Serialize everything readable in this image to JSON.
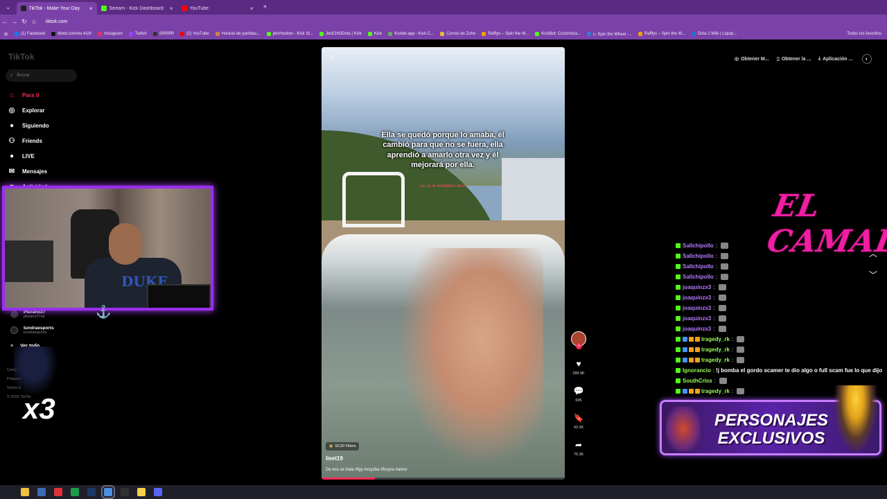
{
  "browser": {
    "tabs": [
      {
        "label": "TikTok - Make Your Day",
        "color": "#222222",
        "active": true
      },
      {
        "label": "Stream - Kick Dashboard",
        "color": "#53fc18",
        "active": false
      },
      {
        "label": "YouTube",
        "color": "#ff0000",
        "active": false
      }
    ],
    "url": "tiktok.com",
    "bookmarks": [
      {
        "label": "(1) Facebook",
        "color": "#1877f2"
      },
      {
        "label": "tiktok.com/es-419/",
        "color": "#111111"
      },
      {
        "label": "Instagram",
        "color": "#e1306c"
      },
      {
        "label": "Twitch",
        "color": "#9146ff"
      },
      {
        "label": "SRRRR",
        "color": "#333333"
      },
      {
        "label": "(2) YouTube",
        "color": "#ff0000"
      },
      {
        "label": "Horario de partidas...",
        "color": "#cc8844"
      },
      {
        "label": "jerichodoto - Kick St...",
        "color": "#53fc18"
      },
      {
        "label": "JeriCHODota | Kick",
        "color": "#53fc18"
      },
      {
        "label": "Kick",
        "color": "#53fc18"
      },
      {
        "label": "Kicklet.app - Kick C...",
        "color": "#66aa66"
      },
      {
        "label": "Correo de Zoho",
        "color": "#e8b93a"
      },
      {
        "label": "Rafflys – Spin the W...",
        "color": "#f0a000"
      },
      {
        "label": "KickBot: Customiza...",
        "color": "#53fc18"
      },
      {
        "label": "▷ Spin the Wheel -...",
        "color": "#3a7bd5"
      },
      {
        "label": "Rafflys – Spin the W...",
        "color": "#f0a000"
      },
      {
        "label": "Dota 2 Wiki | Liquip...",
        "color": "#2a6fd0"
      }
    ],
    "bookmarks_all": "Todos los favoritos"
  },
  "tiktok": {
    "logo": "TikTok",
    "search_placeholder": "Buscar",
    "nav": [
      {
        "label": "Para ti",
        "icon": "home-icon",
        "glyph": "⌂",
        "active": true
      },
      {
        "label": "Explorar",
        "icon": "compass-icon",
        "glyph": "◎",
        "active": false
      },
      {
        "label": "Siguiendo",
        "icon": "following-icon",
        "glyph": "●",
        "active": false
      },
      {
        "label": "Friends",
        "icon": "friends-icon",
        "glyph": "⚇",
        "active": false
      },
      {
        "label": "LIVE",
        "icon": "live-icon",
        "glyph": "●",
        "active": false
      },
      {
        "label": "Mensajes",
        "icon": "messages-icon",
        "glyph": "✉",
        "active": false
      },
      {
        "label": "Actividad",
        "icon": "activity-icon",
        "glyph": "♥",
        "active": false
      }
    ],
    "following": [
      {
        "name": "Plurano27",
        "handle": "plurano27xd"
      },
      {
        "name": "tundraesports",
        "handle": "tundraesports"
      }
    ],
    "see_all": "Ver todo",
    "footer": [
      "Comp",
      "Program",
      "Terms &",
      "© 2026 TikTok"
    ],
    "top_buttons": [
      "Obtener M...",
      "Obtener la ...",
      "Aplicación ..."
    ],
    "video": {
      "caption": "Ella se quedó porque lo amaba, él cambió para que no se fuera, ella aprendió a amarlo otra vez y él mejorará por ella.",
      "caption_sub": "Así es el verdadero amor",
      "filter": "SC20 Filters",
      "author": "lieet19",
      "description": "De eso se trata #fyp #xcyzba #foryou #amor",
      "progress": 0.22
    },
    "actions": [
      {
        "icon": "heart-icon",
        "glyph": "♥",
        "count": "289.9K"
      },
      {
        "icon": "comment-icon",
        "glyph": "💬",
        "count": "695"
      },
      {
        "icon": "bookmark-icon",
        "glyph": "🔖",
        "count": "43.3K"
      },
      {
        "icon": "share-icon",
        "glyph": "➦",
        "count": "75.3K"
      }
    ]
  },
  "overlay": {
    "multiplier": "x3",
    "brand": "EL CAMAL",
    "cam_shirt": "DUKE",
    "promo": "PERSONAJES EXCLUSIVOS",
    "chat": [
      {
        "user": "Sallchipollo",
        "color": "#b57cff",
        "text": "",
        "badges": 1
      },
      {
        "user": "Sallchipollo",
        "color": "#b57cff",
        "text": "",
        "badges": 1
      },
      {
        "user": "Sallchipollo",
        "color": "#b57cff",
        "text": "",
        "badges": 1
      },
      {
        "user": "Sallchipollo",
        "color": "#b57cff",
        "text": "",
        "badges": 1
      },
      {
        "user": "joaquinzx3",
        "color": "#b57cff",
        "text": "",
        "badges": 1
      },
      {
        "user": "joaquinzx3",
        "color": "#b57cff",
        "text": "",
        "badges": 1
      },
      {
        "user": "joaquinzx3",
        "color": "#b57cff",
        "text": "",
        "badges": 1
      },
      {
        "user": "joaquinzx3",
        "color": "#b57cff",
        "text": "",
        "badges": 1
      },
      {
        "user": "joaquinzx3",
        "color": "#b57cff",
        "text": "",
        "badges": 1
      },
      {
        "user": "tragedy_rk",
        "color": "#9bff5a",
        "text": "",
        "badges": 4
      },
      {
        "user": "tragedy_rk",
        "color": "#9bff5a",
        "text": "",
        "badges": 4
      },
      {
        "user": "tragedy_rk",
        "color": "#9bff5a",
        "text": "",
        "badges": 4
      },
      {
        "user": "Ignorancio",
        "color": "#9bff5a",
        "text": "!j bomba el gordo scamer te dio algo o full scam fue lo que dijo",
        "badges": 1
      },
      {
        "user": "SouthCriss",
        "color": "#9bff5a",
        "text": "",
        "badges": 1
      },
      {
        "user": "tragedy_rk",
        "color": "#9bff5a",
        "text": "",
        "badges": 4
      }
    ]
  },
  "taskbar": {
    "apps": [
      {
        "name": "file-explorer-icon",
        "color": "#f0c040"
      },
      {
        "name": "steam-icon",
        "color": "#3b6cb0"
      },
      {
        "name": "opera-icon",
        "color": "#e0303a"
      },
      {
        "name": "excel-icon",
        "color": "#1f9a4a"
      },
      {
        "name": "steam-app-icon",
        "color": "#1b3a66"
      },
      {
        "name": "chrome-icon",
        "color": "#4a90e2"
      },
      {
        "name": "obs-icon",
        "color": "#303030"
      },
      {
        "name": "notes-icon",
        "color": "#f5d04a"
      },
      {
        "name": "discord-icon",
        "color": "#5865f2"
      }
    ]
  }
}
